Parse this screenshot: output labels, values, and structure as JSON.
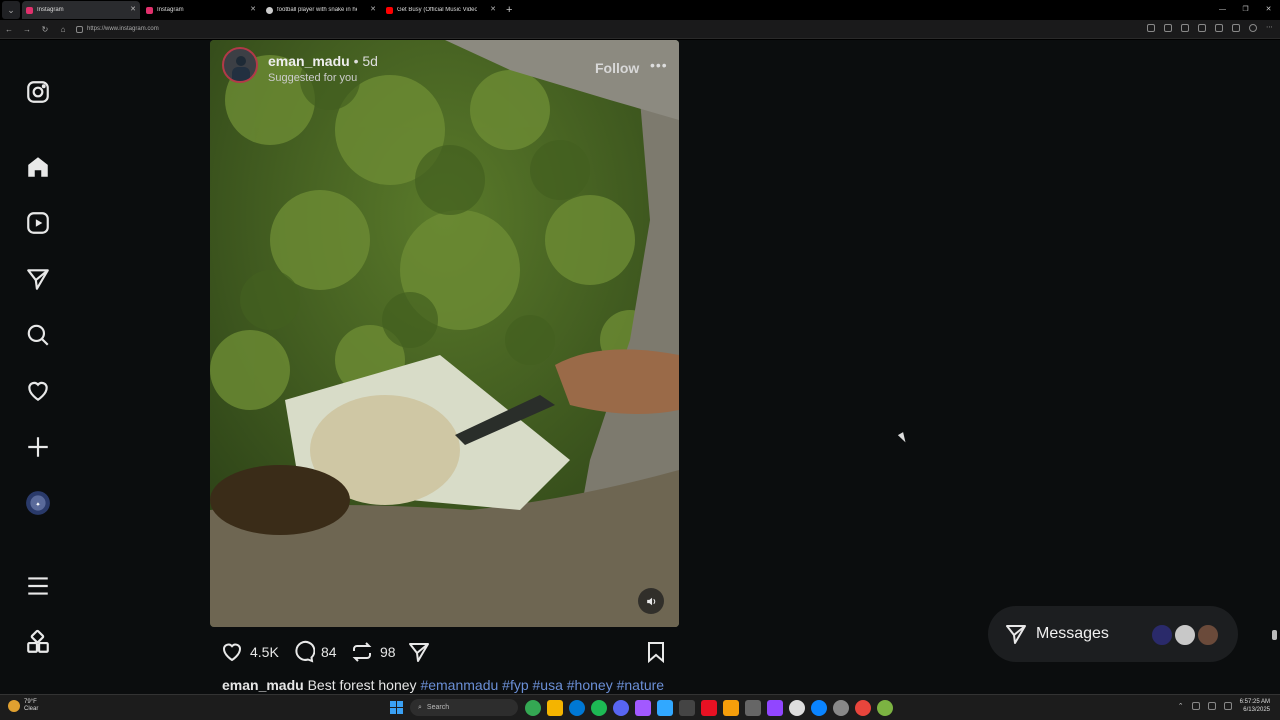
{
  "browser": {
    "tabs": [
      {
        "title": "Instagram",
        "favicon_color": "#e1306c",
        "active": true
      },
      {
        "title": "Instagram",
        "favicon_color": "#e1306c",
        "active": false
      },
      {
        "title": "football player with snake in helm",
        "favicon_color": "#cccccc",
        "active": false
      },
      {
        "title": "Get Busy (Official Music Video) - Y",
        "favicon_color": "#ff0000",
        "active": false
      }
    ],
    "url": "https://www.instagram.com"
  },
  "sidebar": {
    "items": [
      {
        "name": "instagram-logo-icon"
      },
      {
        "name": "home-icon"
      },
      {
        "name": "reels-icon"
      },
      {
        "name": "direct-messages-icon"
      },
      {
        "name": "search-icon"
      },
      {
        "name": "notifications-heart-icon"
      },
      {
        "name": "create-plus-icon"
      },
      {
        "name": "profile-avatar"
      },
      {
        "name": "more-menu-icon"
      },
      {
        "name": "also-from-meta-icon"
      }
    ]
  },
  "post": {
    "username": "eman_madu",
    "time": "• 5d",
    "subtitle": "Suggested for you",
    "follow_label": "Follow",
    "more_label": "•••",
    "likes": "4.5K",
    "comments": "84",
    "reposts": "98",
    "caption_user": "eman_madu",
    "caption_text": " Best forest honey ",
    "hashtags": [
      "#emanmadu",
      "#fyp",
      "#usa",
      "#honey",
      "#nature"
    ]
  },
  "messages": {
    "label": "Messages",
    "avatar_colors": [
      "#2a2a6a",
      "#c8c8c8",
      "#6a4a3a"
    ]
  },
  "taskbar": {
    "weather_temp": "79°F",
    "weather_desc": "Clear",
    "search_placeholder": "Search",
    "app_colors": [
      "#34a853",
      "#f4b400",
      "#0078d4",
      "#1db954",
      "#5865f2",
      "#a259ff",
      "#31a8ff",
      "#444444",
      "#e81123",
      "#f59e0b",
      "#666666",
      "#9146ff",
      "#dddddd",
      "#0a84ff",
      "#888888",
      "#e8453c",
      "#7cb342"
    ],
    "time": "6:57:25 AM",
    "date": "6/13/2025"
  }
}
